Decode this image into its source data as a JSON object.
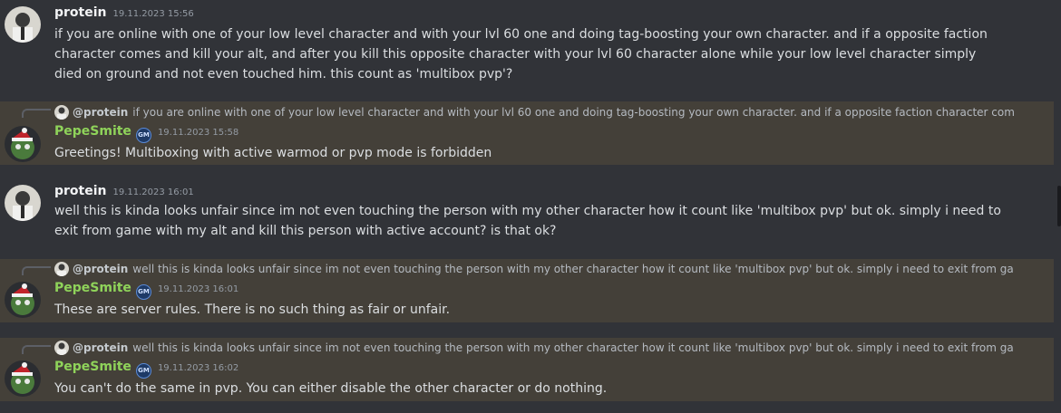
{
  "messages": [
    {
      "author": "protein",
      "timestamp": "19.11.2023 15:56",
      "text": "if you are online with one of your low level character  and with your lvl 60 one and doing tag-boosting your own character. and if a opposite faction character comes and kill your alt, and after you kill this opposite character with your lvl 60 character alone while your low level character simply died on ground and not even touched him. this count as 'multibox pvp'?"
    },
    {
      "reply_to": {
        "name": "@protein",
        "text": "if you are online with one of your low level character and with your lvl 60 one and doing tag-boosting your own character. and if a opposite faction character comes a"
      },
      "author": "PepeSmite",
      "badge": "GM",
      "timestamp": "19.11.2023 15:58",
      "text": "Greetings! Multiboxing with active warmod or pvp mode is forbidden"
    },
    {
      "author": "protein",
      "timestamp": "19.11.2023 16:01",
      "text": "well this is kinda looks unfair since im not even touching the person with my other character how it count like 'multibox pvp' but ok. simply i need to exit from game with my alt and kill this person with active account? is that ok?"
    },
    {
      "reply_to": {
        "name": "@protein",
        "text": "well this is kinda looks unfair since im not even touching the person with my other character how it count like 'multibox pvp' but ok. simply i need to exit from game w"
      },
      "author": "PepeSmite",
      "badge": "GM",
      "timestamp": "19.11.2023 16:01",
      "text": "These are server rules. There is no such thing as fair or unfair."
    },
    {
      "reply_to": {
        "name": "@protein",
        "text": "well this is kinda looks unfair since im not even touching the person with my other character how it count like 'multibox pvp' but ok. simply i need to exit from game w"
      },
      "author": "PepeSmite",
      "badge": "GM",
      "timestamp": "19.11.2023 16:02",
      "text": "You can't do the same in pvp. You can either disable the other character or do nothing."
    }
  ],
  "colors": {
    "background": "#313338",
    "highlight": "#444039",
    "moderator_name": "#8fd35a",
    "timestamp": "#949ba4"
  }
}
